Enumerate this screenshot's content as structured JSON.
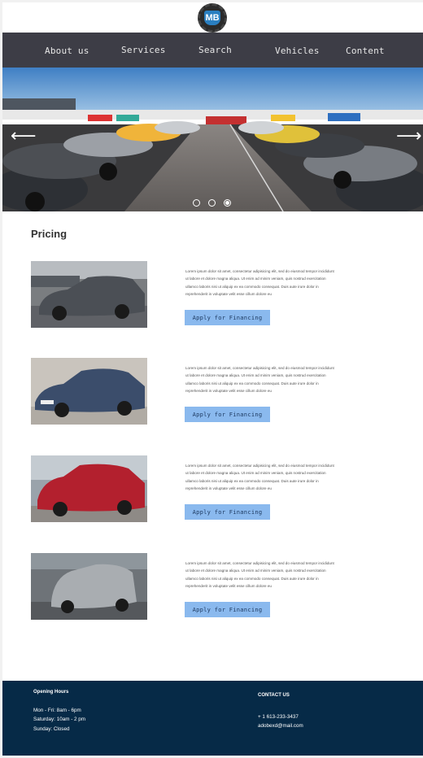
{
  "header": {
    "logo_text": "MB"
  },
  "nav": {
    "items": [
      "About us",
      "Services",
      "Search",
      "Vehicles",
      "Content"
    ]
  },
  "hero": {
    "prev_arrow": "⟵",
    "next_arrow": "⟶",
    "slide_count": 3,
    "active_slide": 3
  },
  "pricing": {
    "title": "Pricing",
    "items": [
      {
        "description": "Lorem ipsum dolor sit amet, consectetur adipisicing elit, sed do eiusmod tempor incididunt ut labore et dolore magna aliqua. Ut enim ad minim veniam, quis nostrud exercitation ullamco laboris nisi ut aliquip ex ea commodo consequat. Duis aute irure dolor in reprehenderit in voluptate velit esse cillum dolore eu",
        "button_label": "Apply for Financing",
        "car_color": "#4b4f55"
      },
      {
        "description": "Lorem ipsum dolor sit amet, consectetur adipisicing elit, sed do eiusmod tempor incididunt ut labore et dolore magna aliqua. Ut enim ad minim veniam, quis nostrud exercitation ullamco laboris nisi ut aliquip ex ea commodo consequat. Duis aute irure dolor in reprehenderit in voluptate velit esse cillum dolore eu",
        "button_label": "Apply for Financing",
        "car_color": "#3b4d6b"
      },
      {
        "description": "Lorem ipsum dolor sit amet, consectetur adipisicing elit, sed do eiusmod tempor incididunt ut labore et dolore magna aliqua. Ut enim ad minim veniam, quis nostrud exercitation ullamco laboris nisi ut aliquip ex ea commodo consequat. Duis aute irure dolor in reprehenderit in voluptate velit esse cillum dolore eu",
        "button_label": "Apply for Financing",
        "car_color": "#b3202e"
      },
      {
        "description": "Lorem ipsum dolor sit amet, consectetur adipisicing elit, sed do eiusmod tempor incididunt ut labore et dolore magna aliqua. Ut enim ad minim veniam, quis nostrud exercitation ullamco laboris nisi ut aliquip ex ea commodo consequat. Duis aute irure dolor in reprehenderit in voluptate velit esse cillum dolore eu",
        "button_label": "Apply for Financing",
        "car_color": "#a9adb1"
      }
    ]
  },
  "footer": {
    "hours_title": "Opening Hours",
    "hours": [
      "Mon - Fri: 8am - 6pm",
      "Saturday: 10am - 2 pm",
      "Sunday: Closed"
    ],
    "contact_title": "CONTACT US",
    "phone": "+ 1 613-233-3437",
    "email": "adobexd@mail.com"
  },
  "colors": {
    "nav_bg": "#3d3d46",
    "button_bg": "#8ab9ee",
    "footer_bg": "#062a47"
  }
}
